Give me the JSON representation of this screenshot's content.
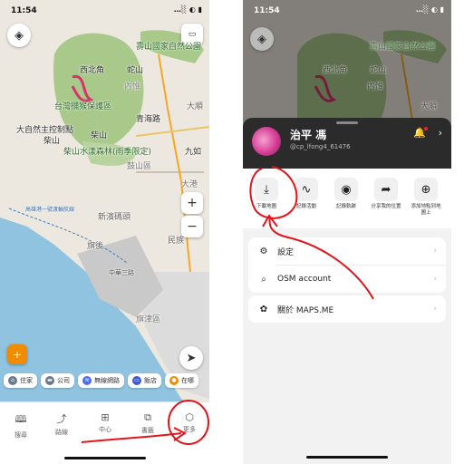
{
  "status": {
    "time": "11:54",
    "signal": "…░ ◐ ▮"
  },
  "map": {
    "labels": {
      "shoushan_park": "壽山國家自然公園",
      "northwest": "西北角",
      "snake_mtn": "蛇山",
      "neiwei": "內惟",
      "macaque": "台灣獼猴保護區",
      "qinghai": "青海路",
      "control_point": "大自然主控制點",
      "chaishan": "柴山",
      "chaishan2": "柴山",
      "forest": "柴山水漾森林(雨季限定)",
      "jiuru": "九如",
      "gushan": "鼓山區",
      "datong": "大港",
      "xinbin": "新濱碼頭",
      "qijin": "旗後",
      "zhonghua": "中華三路",
      "qijin_area": "旗津區",
      "minzu": "民族",
      "daye": "大順",
      "ferry": "高雄港一號渡輪航線"
    },
    "zoom_in": "+",
    "zoom_out": "−"
  },
  "chips": [
    {
      "label": "住家",
      "icon": "home-icon",
      "color": "#6b7b8c"
    },
    {
      "label": "公司",
      "icon": "briefcase-icon",
      "color": "#6b7b8c"
    },
    {
      "label": "無線網路",
      "icon": "wifi-icon",
      "color": "#4c6ef5"
    },
    {
      "label": "飯店",
      "icon": "bed-icon",
      "color": "#3b5bdb"
    },
    {
      "label": "在哪",
      "icon": "pin-icon",
      "color": "#f08c00"
    }
  ],
  "bottom_nav": [
    {
      "label": "搜尋",
      "icon": "book-icon"
    },
    {
      "label": "路線",
      "icon": "route-icon"
    },
    {
      "label": "中心",
      "icon": "grid-icon"
    },
    {
      "label": "書籤",
      "icon": "copy-icon"
    },
    {
      "label": "更多",
      "icon": "box-icon"
    }
  ],
  "profile": {
    "name": "治平 馮",
    "username": "@cp_lfong4_61476"
  },
  "actions": [
    {
      "label": "下載地圖",
      "icon": "download-icon",
      "glyph": "⤓"
    },
    {
      "label": "記錄活動",
      "icon": "pulse-icon",
      "glyph": "∿"
    },
    {
      "label": "記錄軌跡",
      "icon": "record-icon",
      "glyph": "◉"
    },
    {
      "label": "分享我的位置",
      "icon": "share-arrow-icon",
      "glyph": "➦"
    },
    {
      "label": "添加地點到地圖上",
      "icon": "add-place-icon",
      "glyph": "⊕"
    }
  ],
  "menu": [
    {
      "label": "設定",
      "icon": "gear-icon",
      "glyph": "⚙"
    },
    {
      "label": "OSM account",
      "icon": "magnifier-icon",
      "glyph": "⌕"
    },
    {
      "label": "關於 MAPS.ME",
      "icon": "about-icon",
      "glyph": "✿"
    }
  ],
  "colors": {
    "park": "#a8c98a",
    "water": "#8fc3df",
    "land": "#ede8df",
    "accent_red": "#e0161c"
  }
}
